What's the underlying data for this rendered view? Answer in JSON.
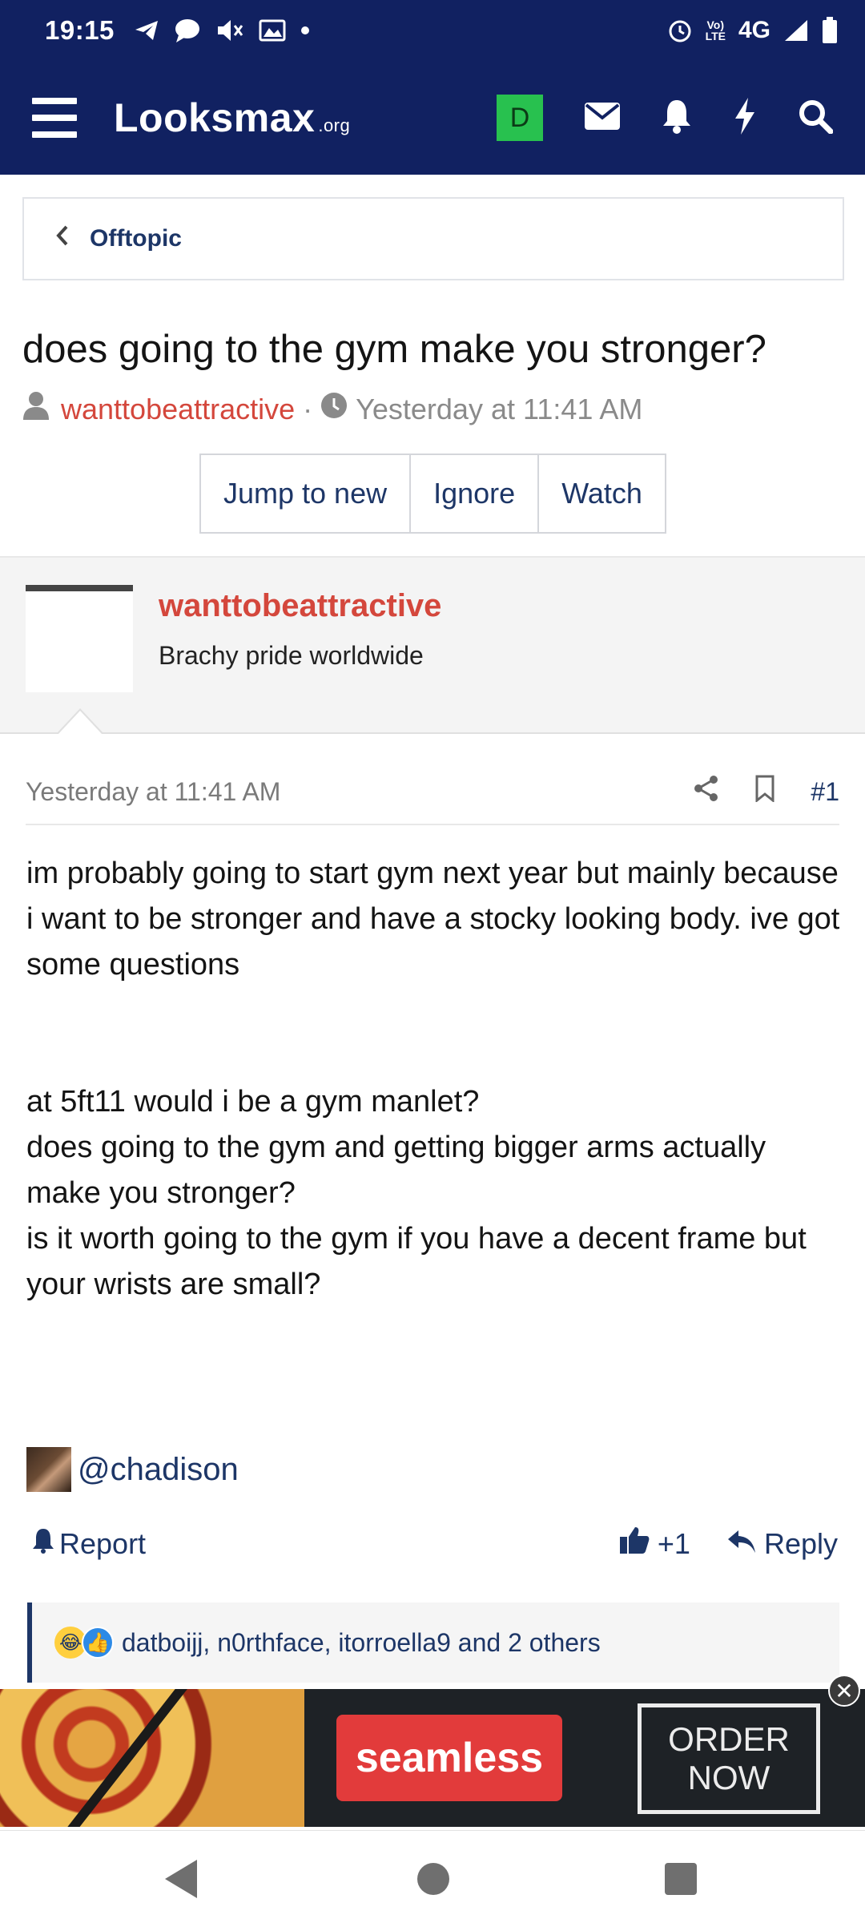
{
  "status_bar": {
    "time": "19:15",
    "network": "4G",
    "lte_label": "LTE",
    "icons": [
      "telegram-icon",
      "chat-bubble-icon",
      "mute-icon",
      "gallery-icon",
      "dot-icon",
      "alarm-icon",
      "volte-icon",
      "signal-icon",
      "battery-icon"
    ]
  },
  "header": {
    "logo_text": "Looksmax",
    "logo_suffix": ".org",
    "avatar_letter": "D",
    "icons": [
      "menu-icon",
      "mail-icon",
      "bell-icon",
      "bolt-icon",
      "search-icon"
    ],
    "colors": {
      "bar": "#112161",
      "avatar": "#28c14f"
    }
  },
  "breadcrumb": {
    "label": "Offtopic"
  },
  "thread": {
    "title": "does going to the gym make you stronger?",
    "author": "wanttobeattractive",
    "separator": "·",
    "date": "Yesterday at 11:41 AM",
    "buttons": {
      "jump": "Jump to new",
      "ignore": "Ignore",
      "watch": "Watch"
    }
  },
  "post": {
    "author": "wanttobeattractive",
    "user_title": "Brachy pride worldwide",
    "date": "Yesterday at 11:41 AM",
    "number": "#1",
    "paragraph1": "im probably going to start gym next year but mainly because i want to be stronger and have a stocky looking body. ive got some questions",
    "q1": "at 5ft11 would i be a gym manlet?",
    "q2": "does going to the gym and getting bigger arms actually make you stronger?",
    "q3": "is it worth going to the gym if you have a decent frame but your wrists are small?",
    "mention": "@chadison",
    "actions": {
      "report": "Report",
      "plus_one": "+1",
      "reply": "Reply"
    },
    "reactions_text": "datboijj, n0rthface, itorroella9 and 2 others"
  },
  "ad": {
    "brand": "seamless",
    "cta_line1": "ORDER",
    "cta_line2": "NOW",
    "close_glyph": "✕"
  },
  "navbar": {
    "buttons": [
      "back-button",
      "home-button",
      "recents-button"
    ]
  }
}
